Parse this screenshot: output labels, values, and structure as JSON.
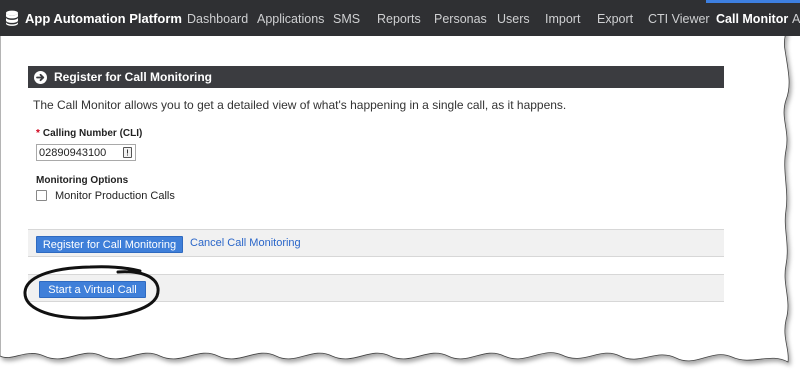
{
  "navbar": {
    "brand": "App Automation Platform",
    "items": [
      {
        "label": "Dashboard",
        "active": false
      },
      {
        "label": "Applications",
        "active": false
      },
      {
        "label": "SMS",
        "active": false
      },
      {
        "label": "Reports",
        "active": false
      },
      {
        "label": "Personas",
        "active": false
      },
      {
        "label": "Users",
        "active": false
      },
      {
        "label": "Import",
        "active": false
      },
      {
        "label": "Export",
        "active": false
      },
      {
        "label": "CTI Viewer",
        "active": false
      },
      {
        "label": "Call Monitor",
        "active": true
      },
      {
        "label": "A",
        "active": false
      }
    ]
  },
  "section": {
    "title": "Register for Call Monitoring",
    "intro": "The Call Monitor allows you to get a detailed view of what's happening in a single call, as it happens."
  },
  "form": {
    "cli_required_mark": "*",
    "cli_label": "Calling Number (CLI)",
    "cli_value": "02890943100",
    "monitoring_label": "Monitoring Options",
    "production_calls_label": "Monitor Production Calls",
    "production_calls_checked": false
  },
  "actions": {
    "register_label": "Register for Call Monitoring",
    "cancel_label": "Cancel Call Monitoring",
    "virtual_call_label": "Start a Virtual Call"
  },
  "colors": {
    "navbar_bg": "#2f3033",
    "header_bg": "#3b3c40",
    "primary_button": "#3f7fd9",
    "link": "#2a66c9",
    "required": "#d0021b"
  }
}
